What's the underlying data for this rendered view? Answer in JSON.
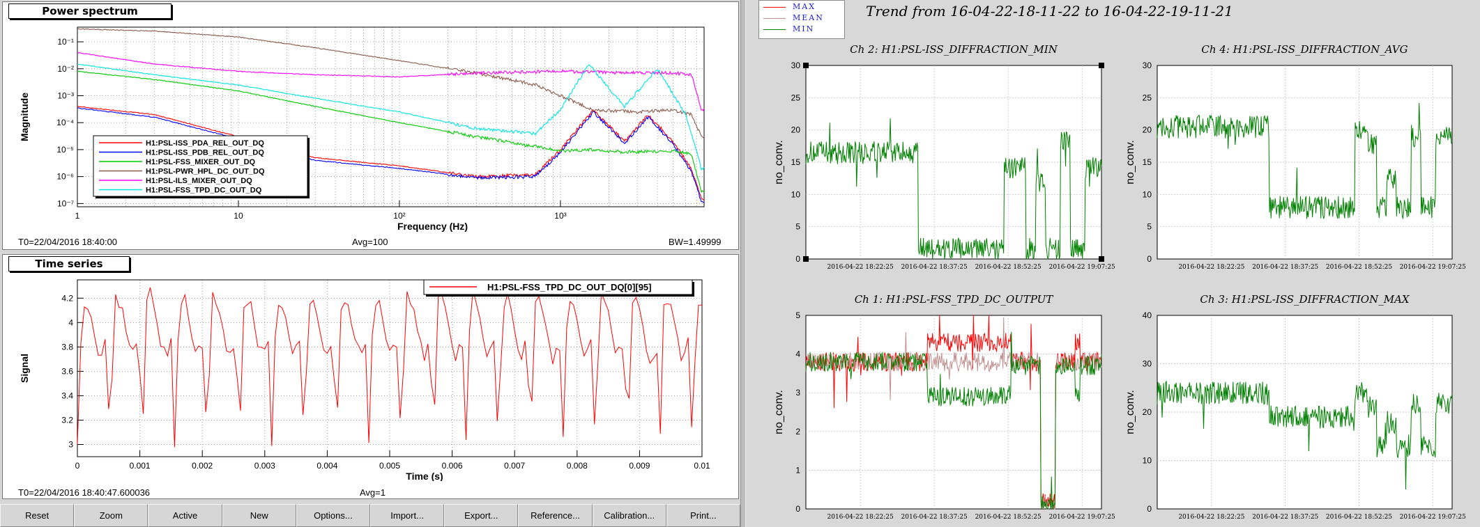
{
  "spectrum": {
    "title": "Power spectrum",
    "ylabel": "Magnitude",
    "xlabel": "Frequency (Hz)",
    "xticks": [
      "1",
      "10",
      "10²",
      "10³"
    ],
    "yticks": [
      "10⁻¹",
      "10⁻²",
      "10⁻³",
      "10⁻⁴",
      "10⁻⁵",
      "10⁻⁶",
      "10⁻⁷"
    ],
    "stats": {
      "t0": "T0=22/04/2016 18:40:00",
      "avg": "Avg=100",
      "bw": "BW=1.49999"
    }
  },
  "timeseries": {
    "title": "Time series",
    "ylabel": "Signal",
    "xlabel": "Time (s)",
    "legend": "H1:PSL-FSS_TPD_DC_OUT_DQ[0][95]",
    "xticks": [
      "0",
      "0.001",
      "0.002",
      "0.003",
      "0.004",
      "0.005",
      "0.006",
      "0.007",
      "0.008",
      "0.009",
      "0.01"
    ],
    "yticks": [
      "3",
      "3.2",
      "3.4",
      "3.6",
      "3.8",
      "4",
      "4.2"
    ],
    "stats": {
      "t0": "T0=22/04/2016 18:40:47.600036",
      "avg": "Avg=1"
    }
  },
  "buttons": [
    "Reset",
    "Zoom",
    "Active",
    "New",
    "Options...",
    "Import...",
    "Export...",
    "Reference...",
    "Calibration...",
    "Print..."
  ],
  "trend": {
    "title": "Trend from 16-04-22-18-11-22 to 16-04-22-19-11-21",
    "legend": [
      {
        "label": "MAX",
        "color": "#ff0000"
      },
      {
        "label": "MEAN",
        "color": "#c09090"
      },
      {
        "label": "MIN",
        "color": "#008000"
      }
    ],
    "xticks": [
      "2016-04-22 18:22:25",
      "2016-04-22 18:37:25",
      "2016-04-22 18:52:25",
      "2016-04-22 19:07:25"
    ]
  },
  "chart_data": [
    {
      "type": "line",
      "title": "Power spectrum",
      "xlabel": "Frequency (Hz)",
      "ylabel": "Magnitude",
      "xscale": "log",
      "yscale": "log",
      "xlim": [
        1,
        1000
      ],
      "ylim": [
        1e-07,
        0.3
      ],
      "grid": true,
      "legend_position": "bottom-left",
      "series": [
        {
          "name": "H1:PSL-ISS_PDA_REL_OUT_DQ",
          "color": "#ff0000",
          "x": [
            1,
            3,
            10,
            30,
            100,
            300,
            700,
            1000,
            1600,
            2500,
            3500,
            5000,
            6500,
            7500
          ],
          "y": [
            0.0004,
            0.0002,
            3e-05,
            5e-06,
            2.5e-06,
            1e-06,
            1.2e-06,
            1e-05,
            0.0003,
            2e-05,
            0.0002,
            2e-05,
            2e-06,
            1.5e-07
          ]
        },
        {
          "name": "H1:PSL-ISS_PDB_REL_OUT_DQ",
          "color": "#0000ff",
          "x": [
            1,
            3,
            10,
            30,
            100,
            300,
            700,
            1000,
            1600,
            2500,
            3500,
            5000,
            6500,
            7500
          ],
          "y": [
            0.00035,
            0.00016,
            2.5e-05,
            4e-06,
            2e-06,
            9e-07,
            1e-06,
            8e-06,
            0.00025,
            1.7e-05,
            0.00016,
            1.6e-05,
            1.6e-06,
            1.2e-07
          ]
        },
        {
          "name": "H1:PSL-FSS_MIXER_OUT_DQ",
          "color": "#00cc00",
          "x": [
            1,
            3,
            10,
            30,
            100,
            300,
            1000,
            1600,
            2500,
            5000,
            6500,
            7500
          ],
          "y": [
            0.008,
            0.004,
            0.0015,
            0.0004,
            0.0001,
            3e-05,
            9e-06,
            1e-05,
            8e-06,
            9e-06,
            7e-06,
            3e-07
          ]
        },
        {
          "name": "H1:PSL-PWR_HPL_DC_OUT_DQ",
          "color": "#8b5a4a",
          "x": [
            1,
            3,
            10,
            30,
            100,
            300,
            700,
            1000,
            1600,
            3000,
            5000,
            6500,
            7500
          ],
          "y": [
            0.3,
            0.25,
            0.15,
            0.06,
            0.02,
            0.007,
            0.0025,
            0.001,
            0.0003,
            0.00025,
            0.0003,
            0.0002,
            3e-05
          ]
        },
        {
          "name": "H1:PSL-ILS_MIXER_OUT_DQ",
          "color": "#ff00ff",
          "x": [
            1,
            3,
            10,
            30,
            100,
            300,
            1000,
            3000,
            5000,
            6500,
            7500
          ],
          "y": [
            0.04,
            0.015,
            0.008,
            0.006,
            0.005,
            0.007,
            0.008,
            0.007,
            0.007,
            0.006,
            0.0003
          ]
        },
        {
          "name": "H1:PSL-FSS_TPD_DC_OUT_DQ",
          "color": "#00e5e5",
          "x": [
            1,
            3,
            10,
            30,
            100,
            300,
            700,
            1000,
            1500,
            2500,
            4000,
            6000,
            7500
          ],
          "y": [
            0.015,
            0.006,
            0.0025,
            0.0008,
            0.00025,
            6e-05,
            4e-05,
            0.0003,
            0.015,
            0.0004,
            0.01,
            0.0002,
            2e-06
          ]
        }
      ]
    },
    {
      "type": "line",
      "title": "Time series",
      "xlabel": "Time (s)",
      "ylabel": "Signal",
      "xlim": [
        0,
        0.01
      ],
      "ylim": [
        2.9,
        4.35
      ],
      "grid": true,
      "legend_position": "top-right",
      "series": [
        {
          "name": "H1:PSL-FSS_TPD_DC_OUT_DQ[0][95]",
          "color": "#ff0000",
          "period": 0.000518,
          "first_trough": 0.00052,
          "max": 4.3,
          "min": 2.97
        }
      ]
    },
    {
      "type": "line",
      "title": "Ch 2: H1:PSL-ISS_DIFFRACTION_MIN",
      "ylabel": "no_conv.",
      "ylim": [
        0,
        30
      ],
      "grid": true,
      "series": [
        {
          "name": "MIN",
          "color": "#008000",
          "x": [
            "2016-04-22 18:11:22",
            "2016-04-22 18:34:00",
            "2016-04-22 18:34:10",
            "2016-04-22 18:51:00",
            "2016-04-22 18:51:30",
            "2016-04-22 18:54:00",
            "2016-04-22 18:56:00",
            "2016-04-22 18:58:00",
            "2016-04-22 19:00:00",
            "2016-04-22 19:03:00",
            "2016-04-22 19:05:00",
            "2016-04-22 19:08:00",
            "2016-04-22 19:11:21"
          ],
          "y": [
            16.5,
            15.5,
            1.5,
            1.5,
            14,
            15,
            1.5,
            12,
            1.5,
            18,
            1.5,
            14,
            15
          ]
        }
      ]
    },
    {
      "type": "line",
      "title": "Ch 4: H1:PSL-ISS_DIFFRACTION_AVG",
      "ylabel": "no_conv.",
      "ylim": [
        0,
        30
      ],
      "grid": true,
      "series": [
        {
          "name": "MEAN",
          "color": "#008000",
          "x": [
            "2016-04-22 18:11:22",
            "2016-04-22 18:34:00",
            "2016-04-22 18:34:10",
            "2016-04-22 18:51:00",
            "2016-04-22 18:51:30",
            "2016-04-22 18:54:00",
            "2016-04-22 18:56:00",
            "2016-04-22 18:58:00",
            "2016-04-22 19:00:00",
            "2016-04-22 19:03:00",
            "2016-04-22 19:05:00",
            "2016-04-22 19:08:00",
            "2016-04-22 19:11:21"
          ],
          "y": [
            20.5,
            20.5,
            8,
            7.5,
            20,
            18,
            8,
            12.5,
            8,
            19,
            8,
            19,
            20
          ]
        }
      ]
    },
    {
      "type": "line",
      "title": "Ch 1: H1:PSL-FSS_TPD_DC_OUTPUT",
      "ylabel": "no_conv.",
      "ylim": [
        0,
        5
      ],
      "grid": true,
      "series": [
        {
          "name": "MAX",
          "color": "#ff0000",
          "x": [
            "2016-04-22 18:11:22",
            "2016-04-22 18:35:00",
            "2016-04-22 18:36:00",
            "2016-04-22 18:52:00",
            "2016-04-22 18:53:00",
            "2016-04-22 18:58:00",
            "2016-04-22 18:59:00",
            "2016-04-22 19:01:00",
            "2016-04-22 19:02:00",
            "2016-04-22 19:06:00",
            "2016-04-22 19:07:00",
            "2016-04-22 19:11:21"
          ],
          "y": [
            3.8,
            3.8,
            4.3,
            4.3,
            3.8,
            3.8,
            0.2,
            0.2,
            3.8,
            4.3,
            3.8,
            3.8
          ]
        },
        {
          "name": "MEAN",
          "color": "#c09090",
          "x": [
            "2016-04-22 18:11:22",
            "2016-04-22 18:35:00",
            "2016-04-22 18:36:00",
            "2016-04-22 18:52:00",
            "2016-04-22 18:53:00",
            "2016-04-22 18:58:00",
            "2016-04-22 18:59:00",
            "2016-04-22 19:01:00",
            "2016-04-22 19:02:00",
            "2016-04-22 19:06:00",
            "2016-04-22 19:07:00",
            "2016-04-22 19:11:21"
          ],
          "y": [
            3.8,
            3.8,
            3.8,
            3.8,
            3.8,
            3.8,
            0.15,
            0.15,
            3.8,
            3.8,
            3.8,
            3.8
          ]
        },
        {
          "name": "MIN",
          "color": "#008000",
          "x": [
            "2016-04-22 18:11:22",
            "2016-04-22 18:35:00",
            "2016-04-22 18:36:00",
            "2016-04-22 18:52:00",
            "2016-04-22 18:53:00",
            "2016-04-22 18:58:00",
            "2016-04-22 18:59:00",
            "2016-04-22 19:01:00",
            "2016-04-22 19:02:00",
            "2016-04-22 19:06:00",
            "2016-04-22 19:07:00",
            "2016-04-22 19:11:21"
          ],
          "y": [
            3.8,
            3.8,
            2.9,
            3.0,
            3.7,
            3.7,
            0.1,
            0.1,
            3.7,
            3.0,
            3.7,
            3.8
          ]
        }
      ]
    },
    {
      "type": "line",
      "title": "Ch 3: H1:PSL-ISS_DIFFRACTION_MAX",
      "ylabel": "no_conv.",
      "ylim": [
        0,
        40
      ],
      "grid": true,
      "series": [
        {
          "name": "MAX",
          "color": "#008000",
          "x": [
            "2016-04-22 18:11:22",
            "2016-04-22 18:34:00",
            "2016-04-22 18:34:10",
            "2016-04-22 18:51:00",
            "2016-04-22 18:51:30",
            "2016-04-22 18:54:00",
            "2016-04-22 18:56:00",
            "2016-04-22 18:58:00",
            "2016-04-22 19:00:00",
            "2016-04-22 19:03:00",
            "2016-04-22 19:05:00",
            "2016-04-22 19:08:00",
            "2016-04-22 19:11:21"
          ],
          "y": [
            24,
            24,
            19,
            18.5,
            24,
            21,
            13,
            18,
            13,
            22,
            13,
            22,
            23
          ]
        }
      ]
    }
  ]
}
